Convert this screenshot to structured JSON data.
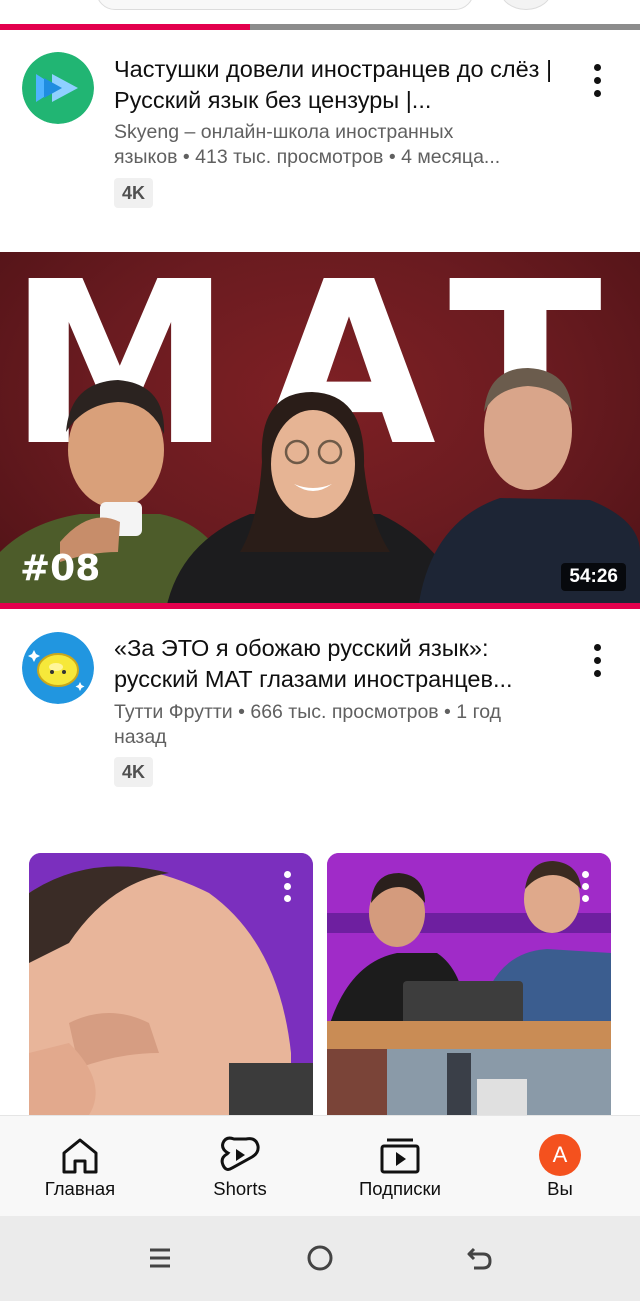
{
  "top": {
    "progress_percent": 39
  },
  "videos": [
    {
      "title": "Частушки довели иностранцев до слёз | Русский язык без цензуры |...",
      "channel_line_1": "Skyeng – онлайн-школа иностранных",
      "channel_line_2": "языков • 413 тыс. просмотров • 4 месяца...",
      "badge": "4K",
      "avatar_icon": "skyeng-logo-icon"
    },
    {
      "thumbnail_word": "MAT",
      "thumbnail_tag": "#08",
      "duration": "54:26",
      "watched_percent": 100,
      "title_line_1": "«За ЭТО я обожаю русский язык»:",
      "title_line_2": "русский МАТ глазами иностранцев...",
      "channel_line_1": "Тутти Фрутти • 666 тыс. просмотров • 1 год",
      "channel_line_2": "назад",
      "badge": "4K",
      "avatar_icon": "tutti-frutti-lemon-icon"
    }
  ],
  "shorts": [
    {
      "icon": "more-vert-icon"
    },
    {
      "icon": "more-vert-icon"
    }
  ],
  "bottom_nav": {
    "items": [
      {
        "label": "Главная",
        "icon": "home-icon"
      },
      {
        "label": "Shorts",
        "icon": "shorts-icon"
      },
      {
        "label": "Подписки",
        "icon": "subscriptions-icon"
      },
      {
        "label": "Вы",
        "icon": "account-avatar"
      }
    ],
    "avatar_letter": "A"
  },
  "colors": {
    "accent_red": "#e3004d",
    "avatar_orange": "#f4511e",
    "shorts_purple": "#8a35c9"
  }
}
